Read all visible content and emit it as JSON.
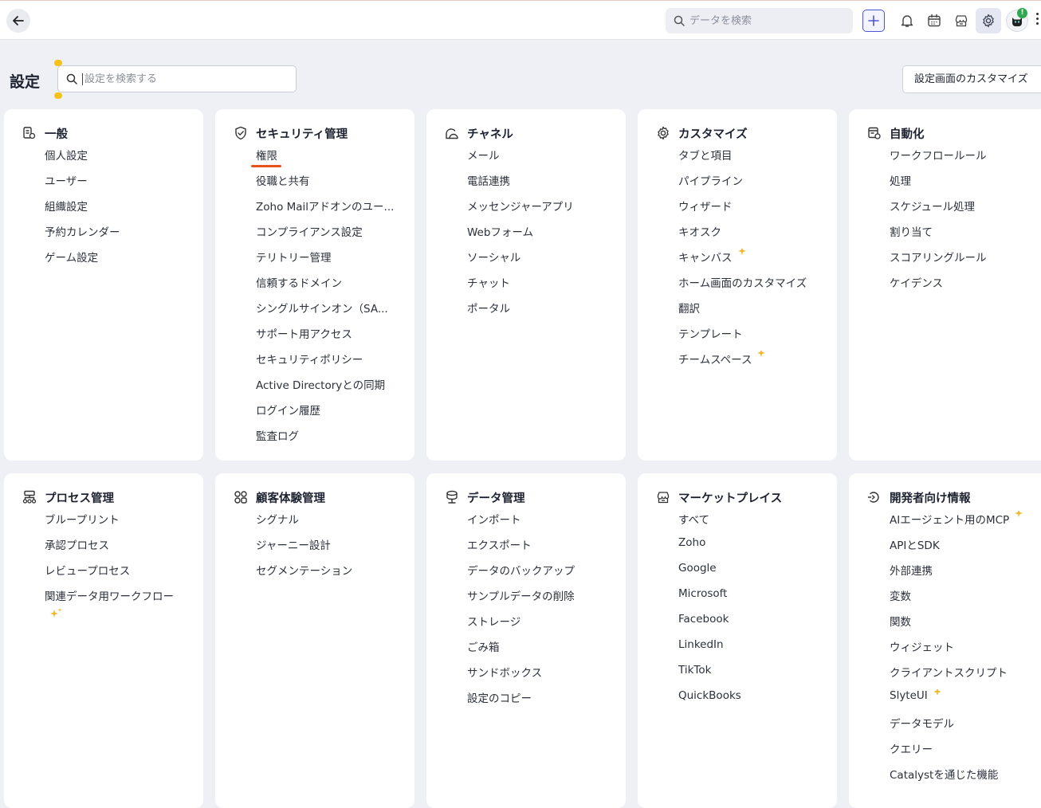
{
  "topbar": {
    "search_placeholder": "データを検索",
    "icons": [
      "back-arrow-icon",
      "search-icon",
      "plus-icon",
      "bell-icon",
      "calendar-icon",
      "marketplace-icon",
      "gear-icon",
      "avatar",
      "more-icon"
    ],
    "badge": "!"
  },
  "page": {
    "title": "設定",
    "search_placeholder": "設定を検索する",
    "customize_button": "設定画面のカスタマイズ"
  },
  "accent": "#e8521a",
  "sparkle_color": "#f1b92c",
  "cards": {
    "general": {
      "title": "一般",
      "items": [
        "個人設定",
        "ユーザー",
        "組織設定",
        "予約カレンダー",
        "ゲーム設定"
      ]
    },
    "security": {
      "title": "セキュリティ管理",
      "items": [
        "権限",
        "役職と共有",
        "Zoho Mailアドオンのユー...",
        "コンプライアンス設定",
        "テリトリー管理",
        "信頼するドメイン",
        "シングルサインオン（SA...",
        "サポート用アクセス",
        "セキュリティポリシー",
        "Active Directoryとの同期",
        "ログイン履歴",
        "監査ログ"
      ]
    },
    "channels": {
      "title": "チャネル",
      "items": [
        "メール",
        "電話連携",
        "メッセンジャーアプリ",
        "Webフォーム",
        "ソーシャル",
        "チャット",
        "ポータル"
      ]
    },
    "customize": {
      "title": "カスタマイズ",
      "items": [
        "タブと項目",
        "パイプライン",
        "ウィザード",
        "キオスク",
        "キャンバス",
        "ホーム画面のカスタマイズ",
        "翻訳",
        "テンプレート",
        "チームスペース"
      ]
    },
    "automation": {
      "title": "自動化",
      "items": [
        "ワークフロールール",
        "処理",
        "スケジュール処理",
        "割り当て",
        "スコアリングルール",
        "ケイデンス"
      ]
    },
    "process": {
      "title": "プロセス管理",
      "items": [
        "ブループリント",
        "承認プロセス",
        "レビュープロセス",
        "関連データ用ワークフロー"
      ]
    },
    "cx": {
      "title": "顧客体験管理",
      "items": [
        "シグナル",
        "ジャーニー設計",
        "セグメンテーション"
      ]
    },
    "data": {
      "title": "データ管理",
      "items": [
        "インポート",
        "エクスポート",
        "データのバックアップ",
        "サンプルデータの削除",
        "ストレージ",
        "ごみ箱",
        "サンドボックス",
        "設定のコピー"
      ]
    },
    "marketplace": {
      "title": "マーケットプレイス",
      "items": [
        "すべて",
        "Zoho",
        "Google",
        "Microsoft",
        "Facebook",
        "LinkedIn",
        "TikTok",
        "QuickBooks"
      ]
    },
    "developer": {
      "title": "開発者向け情報",
      "items": [
        "AIエージェント用のMCP",
        "APIとSDK",
        "外部連携",
        "変数",
        "関数",
        "ウィジェット",
        "クライアントスクリプト",
        "SlyteUI",
        "データモデル",
        "クエリー",
        "Catalystを通じた機能"
      ]
    }
  }
}
